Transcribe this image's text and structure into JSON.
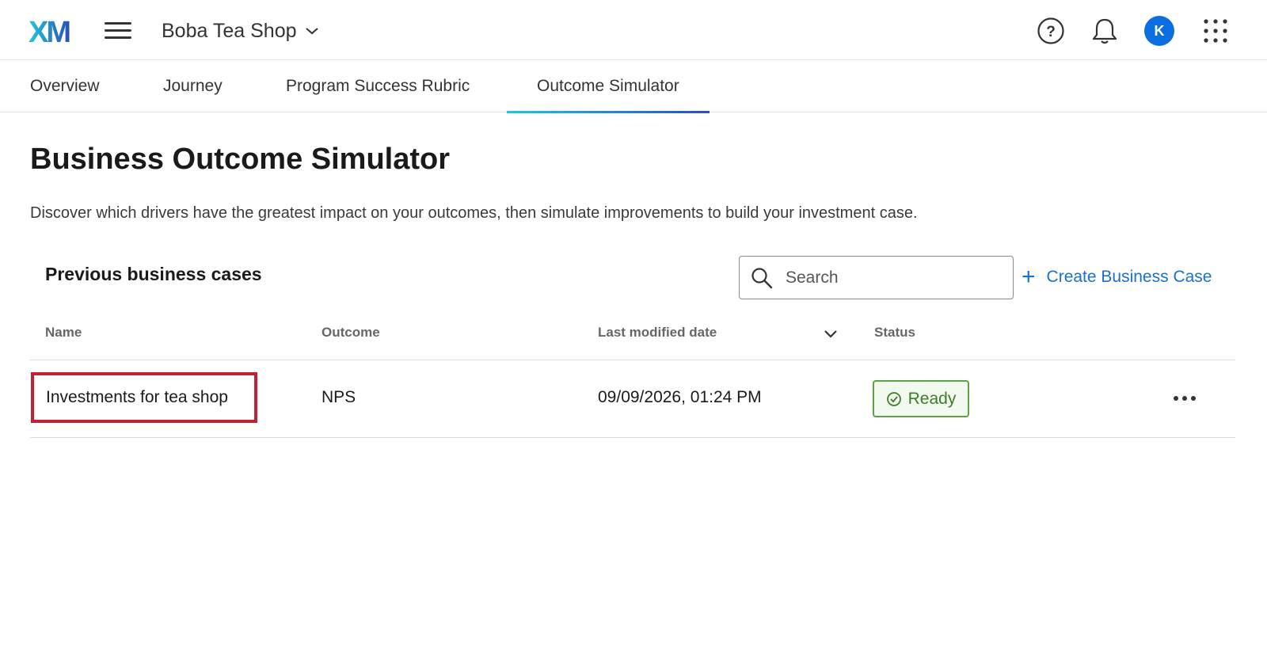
{
  "header": {
    "logo_text": "XM",
    "project_name": "Boba Tea Shop",
    "avatar_initial": "K"
  },
  "tabs": [
    {
      "label": "Overview",
      "active": false
    },
    {
      "label": "Journey",
      "active": false
    },
    {
      "label": "Program Success Rubric",
      "active": false
    },
    {
      "label": "Outcome Simulator",
      "active": true
    }
  ],
  "page": {
    "title": "Business Outcome Simulator",
    "description": "Discover which drivers have the greatest impact on your outcomes, then simulate improvements to build your investment case."
  },
  "cases": {
    "section_title": "Previous business cases",
    "search_placeholder": "Search",
    "create_label": "Create Business Case",
    "columns": {
      "name": "Name",
      "outcome": "Outcome",
      "modified": "Last modified date",
      "status": "Status"
    },
    "rows": [
      {
        "name": "Investments for tea shop",
        "outcome": "NPS",
        "modified": "09/09/2026, 01:24 PM",
        "status": "Ready"
      }
    ]
  },
  "colors": {
    "accent_blue": "#1a6fd1",
    "avatar_blue": "#0b6ee0",
    "status_green": "#3d7d2a",
    "highlight_red": "#c22033"
  },
  "icons": [
    "xm-logo-icon",
    "hamburger-menu-icon",
    "chevron-down-icon",
    "help-icon",
    "bell-icon",
    "app-grid-icon",
    "search-icon",
    "plus-icon",
    "sort-chevron-icon",
    "check-circle-icon",
    "more-options-icon"
  ]
}
